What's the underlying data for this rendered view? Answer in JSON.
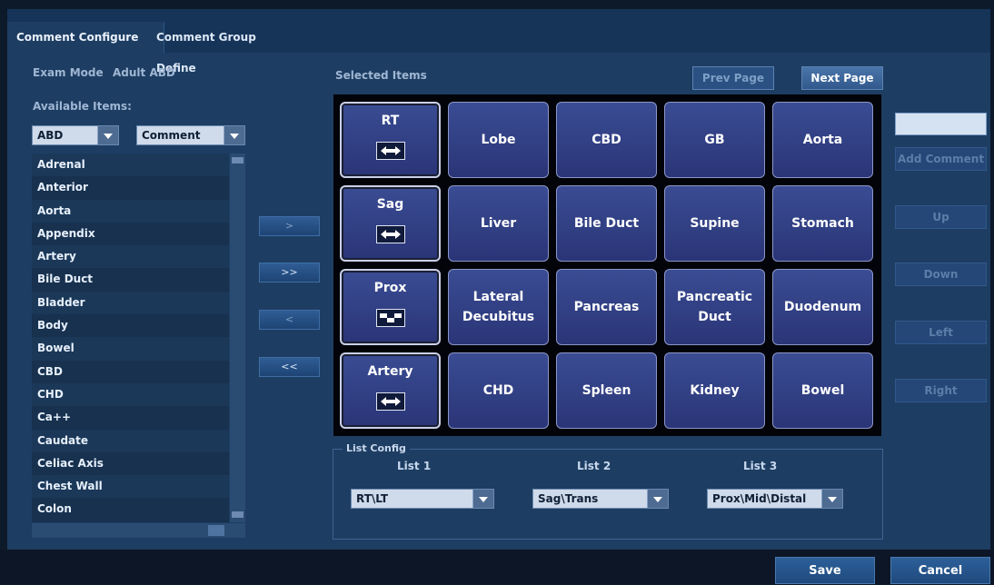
{
  "tabs": [
    "Comment Configure",
    "Comment Group Define"
  ],
  "exam_mode_label": "Exam Mode",
  "exam_mode_value": "Adult ABD",
  "available_items_label": "Available Items:",
  "category_select": "ABD",
  "type_select": "Comment",
  "available_items": [
    "Adrenal",
    "Anterior",
    "Aorta",
    "Appendix",
    "Artery",
    "Bile Duct",
    "Bladder",
    "Body",
    "Bowel",
    "CBD",
    "CHD",
    "Ca++",
    "Caudate",
    "Celiac Axis",
    "Chest Wall",
    "Colon"
  ],
  "move_buttons": [
    ">",
    ">>",
    "<",
    "<<"
  ],
  "selected_items_label": "Selected Items",
  "prev_page": "Prev Page",
  "next_page": "Next Page",
  "grid_rows": [
    [
      "RT",
      "Lobe",
      "CBD",
      "GB",
      "Aorta"
    ],
    [
      "Sag",
      "Liver",
      "Bile Duct",
      "Supine",
      "Stomach"
    ],
    [
      "Prox",
      "Lateral Decubitus",
      "Pancreas",
      "Pancreatic Duct",
      "Duodenum"
    ],
    [
      "Artery",
      "CHD",
      "Spleen",
      "Kidney",
      "Bowel"
    ]
  ],
  "add_comment_value": "",
  "side_buttons": [
    "Add Comment",
    "Up",
    "Down",
    "Left",
    "Right"
  ],
  "list_config": {
    "legend": "List Config",
    "headers": [
      "List 1",
      "List 2",
      "List 3"
    ],
    "values": [
      "RT\\LT",
      "Sag\\Trans",
      "Prox\\Mid\\Distal"
    ]
  },
  "save_label": "Save",
  "cancel_label": "Cancel",
  "colors": {
    "panel": "#1e3d62",
    "tile": "#2f3d83",
    "button": "#2d5f99"
  }
}
